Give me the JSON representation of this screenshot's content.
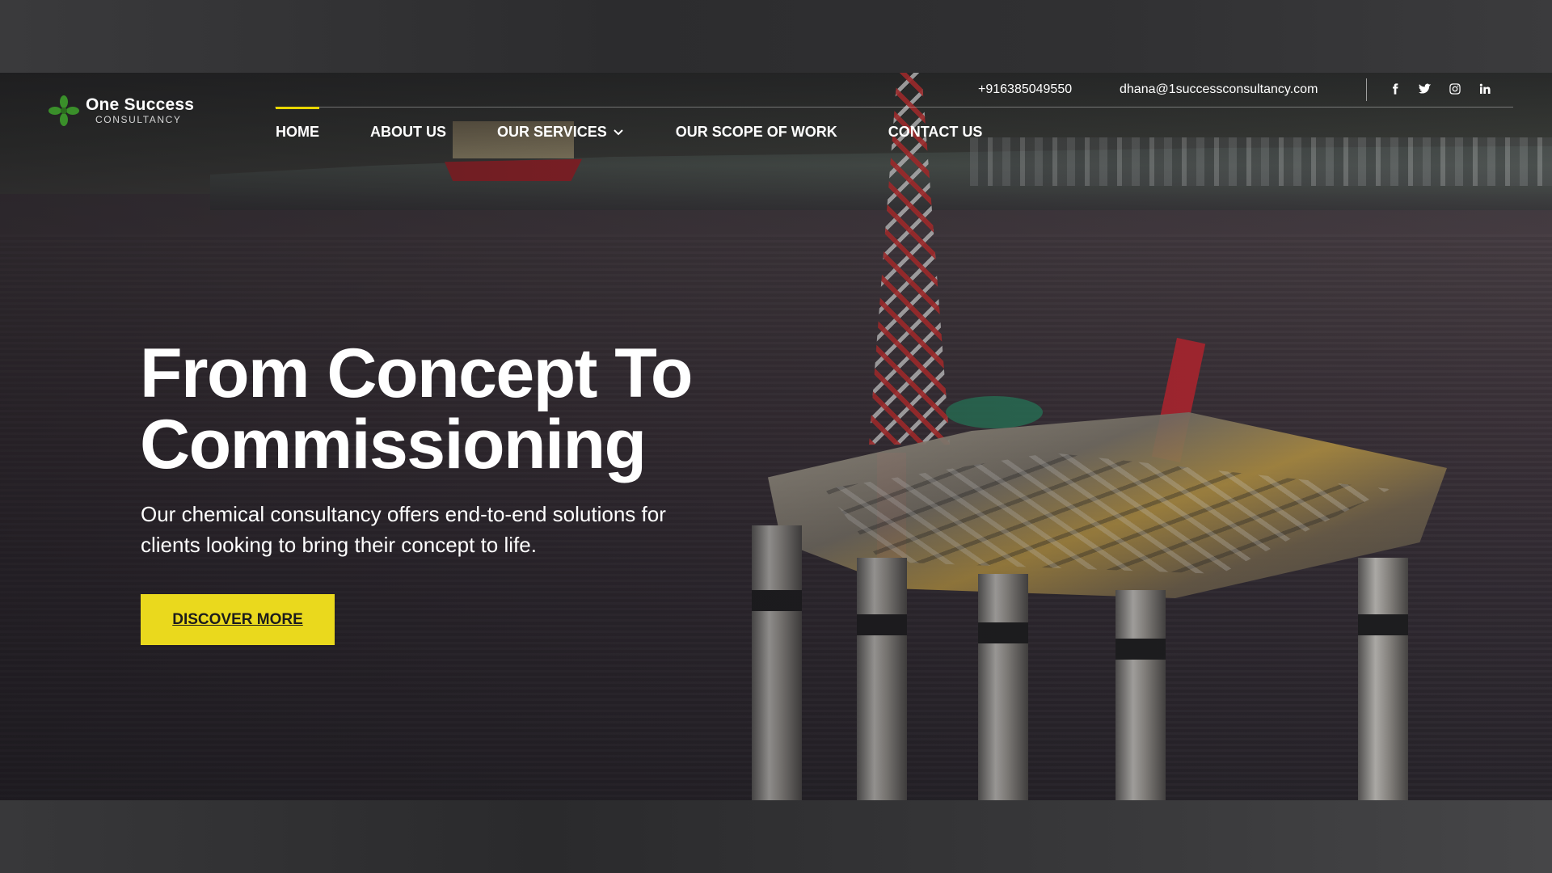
{
  "brand": {
    "name": "One Success",
    "tagline": "CONSULTANCY",
    "logo_icon": "leaf-cross-logo-icon",
    "accent_color": "#ead91d",
    "logo_green": "#3a8f2a"
  },
  "topbar": {
    "phone": "+916385049550",
    "email": "dhana@1successconsultancy.com",
    "socials": [
      {
        "name": "facebook",
        "icon": "facebook-icon"
      },
      {
        "name": "twitter",
        "icon": "twitter-icon"
      },
      {
        "name": "instagram",
        "icon": "instagram-icon"
      },
      {
        "name": "linkedin",
        "icon": "linkedin-icon"
      }
    ]
  },
  "nav": {
    "items": [
      {
        "label": "HOME",
        "active": true
      },
      {
        "label": "ABOUT US",
        "active": false
      },
      {
        "label": "OUR SERVICES",
        "active": false,
        "has_dropdown": true
      },
      {
        "label": "OUR SCOPE OF WORK",
        "active": false
      },
      {
        "label": "CONTACT US",
        "active": false
      }
    ]
  },
  "hero": {
    "headline_line1": "From Concept To",
    "headline_line2": "Commissioning",
    "subtext_line1": "Our chemical consultancy offers end-to-end solutions for",
    "subtext_line2": "clients looking to bring their concept to life.",
    "cta_label": "DISCOVER MORE",
    "background": "offshore-oil-rig-photo"
  }
}
